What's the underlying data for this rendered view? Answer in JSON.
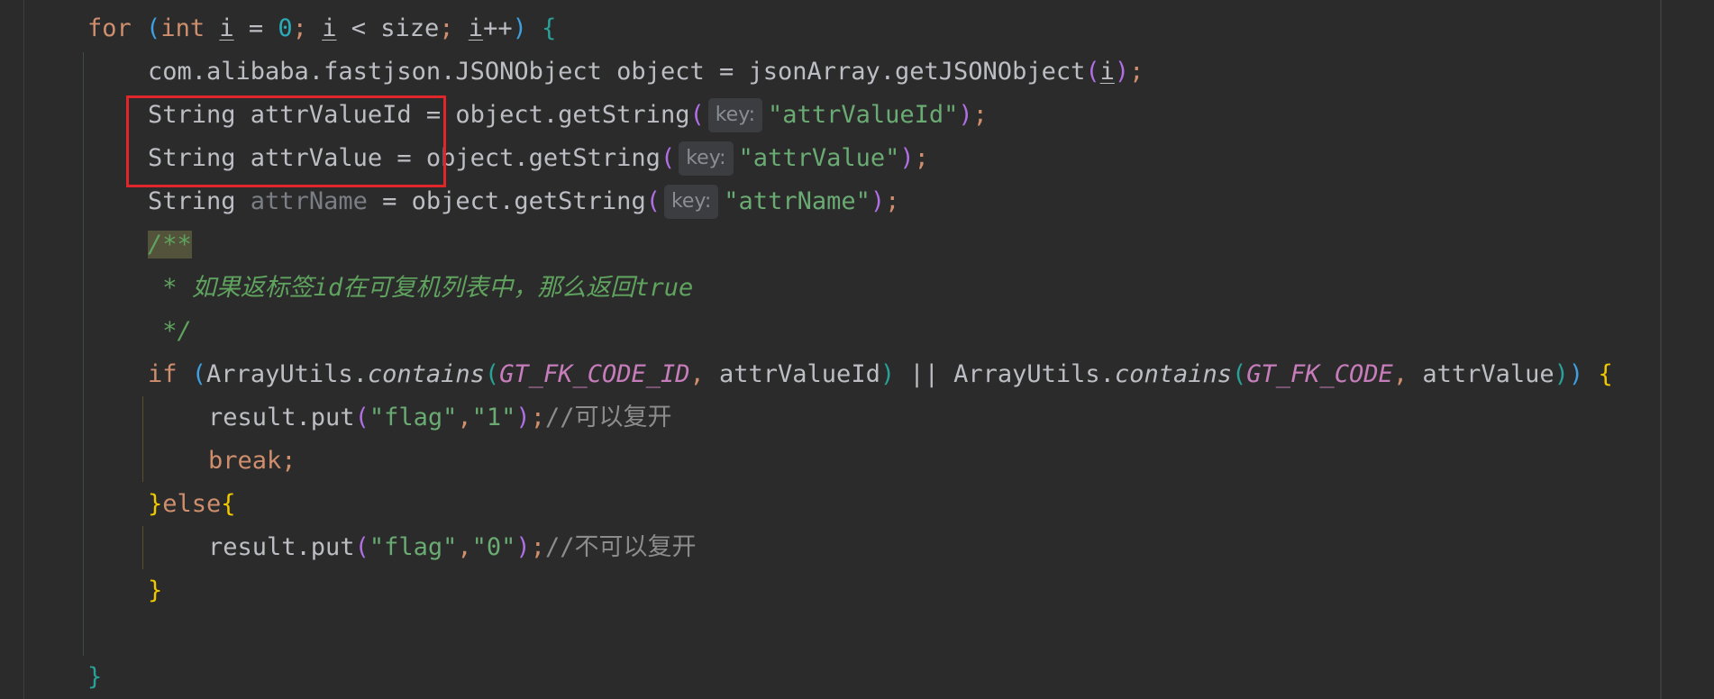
{
  "code": {
    "for_kw": "for",
    "open_paren": "(",
    "int_kw": "int",
    "var_i": "i",
    "eq": " = ",
    "zero": "0",
    "semi": ";",
    "lt": " < size",
    "inc": "++",
    "close_paren": ")",
    "open_brace": "{",
    "l2_text": "com.alibaba.fastjson.JSONObject object = jsonArray.getJSONObject",
    "l3_prefix": "String attrValueId = object.getString",
    "l4_prefix": "String attrValue = object.getString",
    "l5_string": "String ",
    "l5_var": "attrName",
    "l5_rest": " = object.getString",
    "hint_key": "key:",
    "str_attrValueId": "\"attrValueId\"",
    "str_attrValue": "\"attrValue\"",
    "str_attrName": "\"attrName\"",
    "paren_semi": ");",
    "doc_open": "/**",
    "doc_line": " * 如果返标签id在可复机列表中，那么返回true",
    "doc_close": " */",
    "if_kw": "if",
    "array_utils": "ArrayUtils.",
    "contains": "contains",
    "gt_fk_code_id": "GT_FK_CODE_ID",
    "gt_fk_code": "GT_FK_CODE",
    "comma": ", ",
    "attr_value_id": "attrValueId",
    "attr_value": "attrValue",
    "or_op": " || ",
    "result_put": "result.put",
    "str_flag": "\"flag\"",
    "comma_plain": ",",
    "str_1": "\"1\"",
    "str_0": "\"0\"",
    "comment_can": "//可以复开",
    "comment_cannot": "//不可以复开",
    "break_kw": "break",
    "close_brace": "}",
    "else_kw": "else"
  },
  "colors": {
    "background": "#2b2b2b",
    "highlight_border": "#e0262a"
  }
}
